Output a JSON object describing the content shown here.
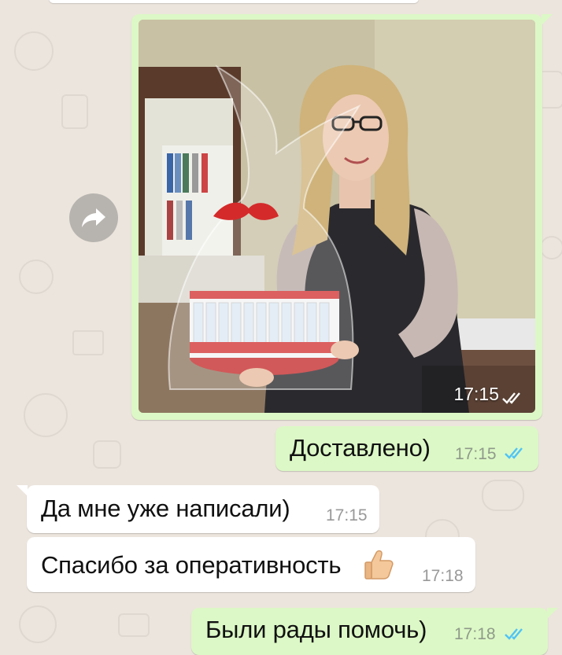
{
  "chat": {
    "photo_message": {
      "time": "17:15",
      "status": "read",
      "image_alt": "Woman holding a gift basket wrapped in cellophane with a red ribbon"
    },
    "messages": [
      {
        "direction": "outgoing",
        "text": "Доставлено)",
        "time": "17:15",
        "status": "read"
      },
      {
        "direction": "incoming",
        "text": "Да мне уже написали)",
        "time": "17:15"
      },
      {
        "direction": "incoming",
        "text": "Спасибо за оперативность",
        "emoji": "thumbs-up",
        "time": "17:18"
      },
      {
        "direction": "outgoing",
        "text": "Были рады помочь)",
        "time": "17:18",
        "status": "read"
      }
    ]
  },
  "colors": {
    "outgoing_bubble": "#dcf8c6",
    "incoming_bubble": "#ffffff",
    "wallpaper": "#ece5dd",
    "read_ticks": "#4fc3f7"
  },
  "icons": {
    "forward": "forward-arrow-icon",
    "read": "double-check-icon",
    "emoji": "thumbs-up-emoji"
  }
}
